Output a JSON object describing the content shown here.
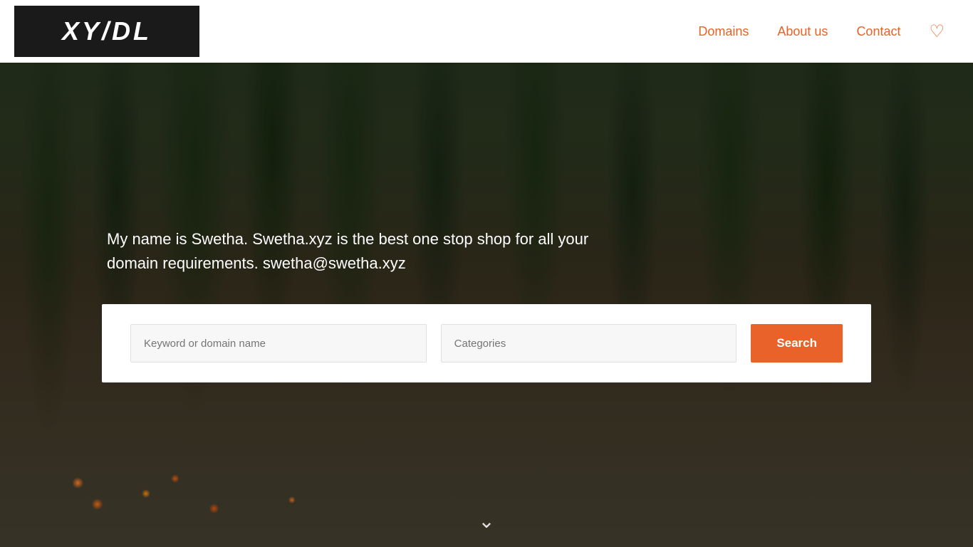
{
  "header": {
    "logo_text": "XYZDL",
    "nav": {
      "domains": "Domains",
      "about_us": "About us",
      "contact": "Contact"
    }
  },
  "hero": {
    "description": "My name is Swetha. Swetha.xyz is the best one stop shop for all your domain requirements. swetha@swetha.xyz"
  },
  "search": {
    "keyword_placeholder": "Keyword or domain name",
    "categories_placeholder": "Categories",
    "button_label": "Search"
  }
}
